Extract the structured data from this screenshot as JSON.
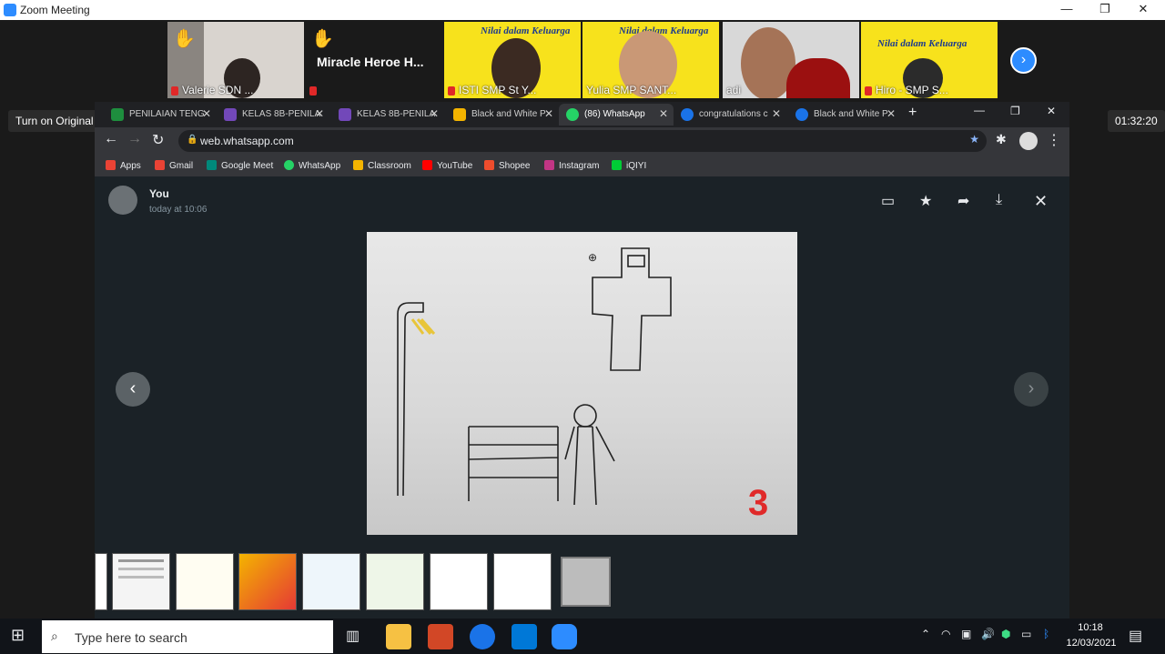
{
  "zoom": {
    "title": "Zoom Meeting",
    "window_controls": [
      "—",
      "❐",
      "✕"
    ],
    "participants": [
      {
        "name": "Valerie SDN ...",
        "muted": true,
        "hand": true
      },
      {
        "name": "Miracle Heroe H...",
        "muted": true,
        "hand": true
      },
      {
        "name": "ISTI SMP St Y...",
        "muted": true,
        "poster_text": "Nilai dalam Keluarga"
      },
      {
        "name": "Yulia SMP SANT...",
        "muted": false,
        "poster_text": "Nilai dalam Keluarga"
      },
      {
        "name": "adi",
        "muted": false
      },
      {
        "name": "Hiro - SMP S...",
        "muted": true,
        "poster_text": "Nilai dalam Keluarga"
      }
    ],
    "original_sound_label": "Turn on Original Sound",
    "timer": "01:32:20",
    "next_icon": "chevron-right-icon"
  },
  "chrome": {
    "tabs": [
      {
        "label": "PENILAIAN TENG",
        "icon_color": "#1e8e3e"
      },
      {
        "label": "KELAS 8B-PENILA",
        "icon_color": "#7248b9"
      },
      {
        "label": "KELAS 8B-PENILA",
        "icon_color": "#7248b9"
      },
      {
        "label": "Black and White P",
        "icon_color": "#f4b400"
      },
      {
        "label": "(86) WhatsApp",
        "icon_color": "#25d366"
      },
      {
        "label": "congratulations c",
        "icon_color": "#1a73e8"
      },
      {
        "label": "Black and White P",
        "icon_color": "#1a73e8"
      }
    ],
    "new_tab": "+",
    "window_controls": [
      "—",
      "❐",
      "✕"
    ],
    "url": "web.whatsapp.com",
    "bookmarks": [
      {
        "label": "Apps",
        "color": "#ea4335"
      },
      {
        "label": "Gmail",
        "color": "#ea4335"
      },
      {
        "label": "Google Meet",
        "color": "#00897b"
      },
      {
        "label": "WhatsApp",
        "color": "#25d366"
      },
      {
        "label": "Classroom",
        "color": "#f4b400"
      },
      {
        "label": "YouTube",
        "color": "#ff0000"
      },
      {
        "label": "Shopee",
        "color": "#ee4d2d"
      },
      {
        "label": "Instagram",
        "color": "#c13584"
      },
      {
        "label": "iQIYI",
        "color": "#00cc36"
      }
    ]
  },
  "viewer": {
    "sender": "You",
    "time": "today at 10:06",
    "drawing_number": "3",
    "actions": [
      "comment-icon",
      "star-icon",
      "forward-icon",
      "download-icon",
      "close-icon"
    ]
  },
  "taskbar": {
    "search_placeholder": "Type here to search",
    "time": "10:18",
    "date": "12/03/2021"
  }
}
